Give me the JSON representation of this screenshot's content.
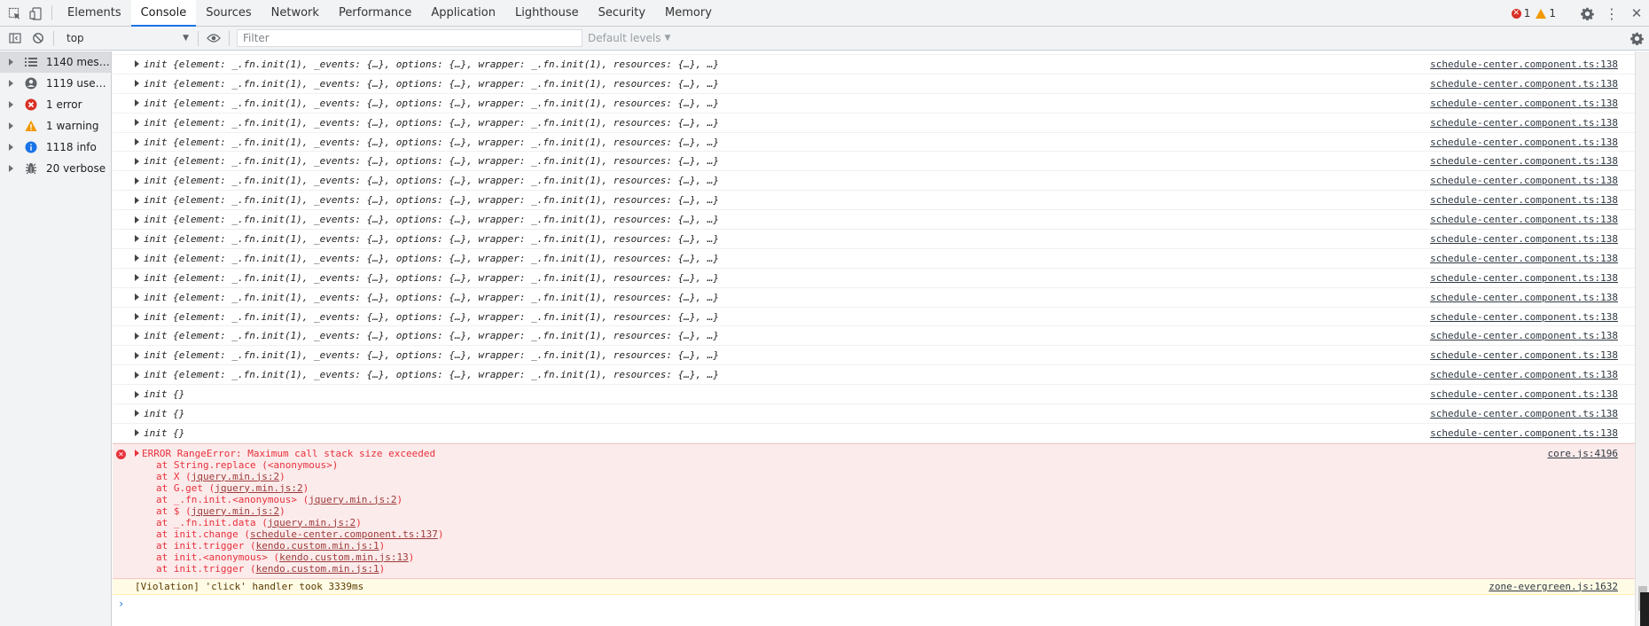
{
  "tabs": {
    "items": [
      "Elements",
      "Console",
      "Sources",
      "Network",
      "Performance",
      "Application",
      "Lighthouse",
      "Security",
      "Memory"
    ],
    "active": "Console"
  },
  "counters": {
    "errors": "1",
    "warnings": "1"
  },
  "toolbar": {
    "context": "top",
    "filter_placeholder": "Filter",
    "levels": "Default levels"
  },
  "sidebar": {
    "items": [
      {
        "label": "1140 mess…",
        "icon": "list-icon"
      },
      {
        "label": "1119 user …",
        "icon": "user-icon"
      },
      {
        "label": "1 error",
        "icon": "error-icon"
      },
      {
        "label": "1 warning",
        "icon": "warning-icon"
      },
      {
        "label": "1118 info",
        "icon": "info-icon"
      },
      {
        "label": "20 verbose",
        "icon": "bug-icon"
      }
    ]
  },
  "console": {
    "log_text": "init {element: _.fn.init(1), _events: {…}, options: {…}, wrapper: _.fn.init(1), resources: {…}, …}",
    "empty_text": "init {}",
    "source": "schedule-center.component.ts:138",
    "error": {
      "header": "ERROR RangeError: Maximum call stack size exceeded",
      "source": "core.js:4196",
      "frames": [
        {
          "prefix": "at String.replace (",
          "link": "<anonymous>",
          "suffix": ")",
          "plain": true
        },
        {
          "prefix": "at X (",
          "link": "jquery.min.js:2",
          "suffix": ")"
        },
        {
          "prefix": "at G.get (",
          "link": "jquery.min.js:2",
          "suffix": ")"
        },
        {
          "prefix": "at _.fn.init.<anonymous> (",
          "link": "jquery.min.js:2",
          "suffix": ")"
        },
        {
          "prefix": "at $ (",
          "link": "jquery.min.js:2",
          "suffix": ")"
        },
        {
          "prefix": "at _.fn.init.data (",
          "link": "jquery.min.js:2",
          "suffix": ")"
        },
        {
          "prefix": "at init.change (",
          "link": "schedule-center.component.ts:137",
          "suffix": ")"
        },
        {
          "prefix": "at init.trigger (",
          "link": "kendo.custom.min.js:1",
          "suffix": ")"
        },
        {
          "prefix": "at init.<anonymous> (",
          "link": "kendo.custom.min.js:13",
          "suffix": ")"
        },
        {
          "prefix": "at init.trigger (",
          "link": "kendo.custom.min.js:1",
          "suffix": ")"
        }
      ]
    },
    "violation": {
      "text": "[Violation] 'click' handler took 3339ms",
      "source": "zone-evergreen.js:1632"
    },
    "prompt_symbol": "›"
  }
}
